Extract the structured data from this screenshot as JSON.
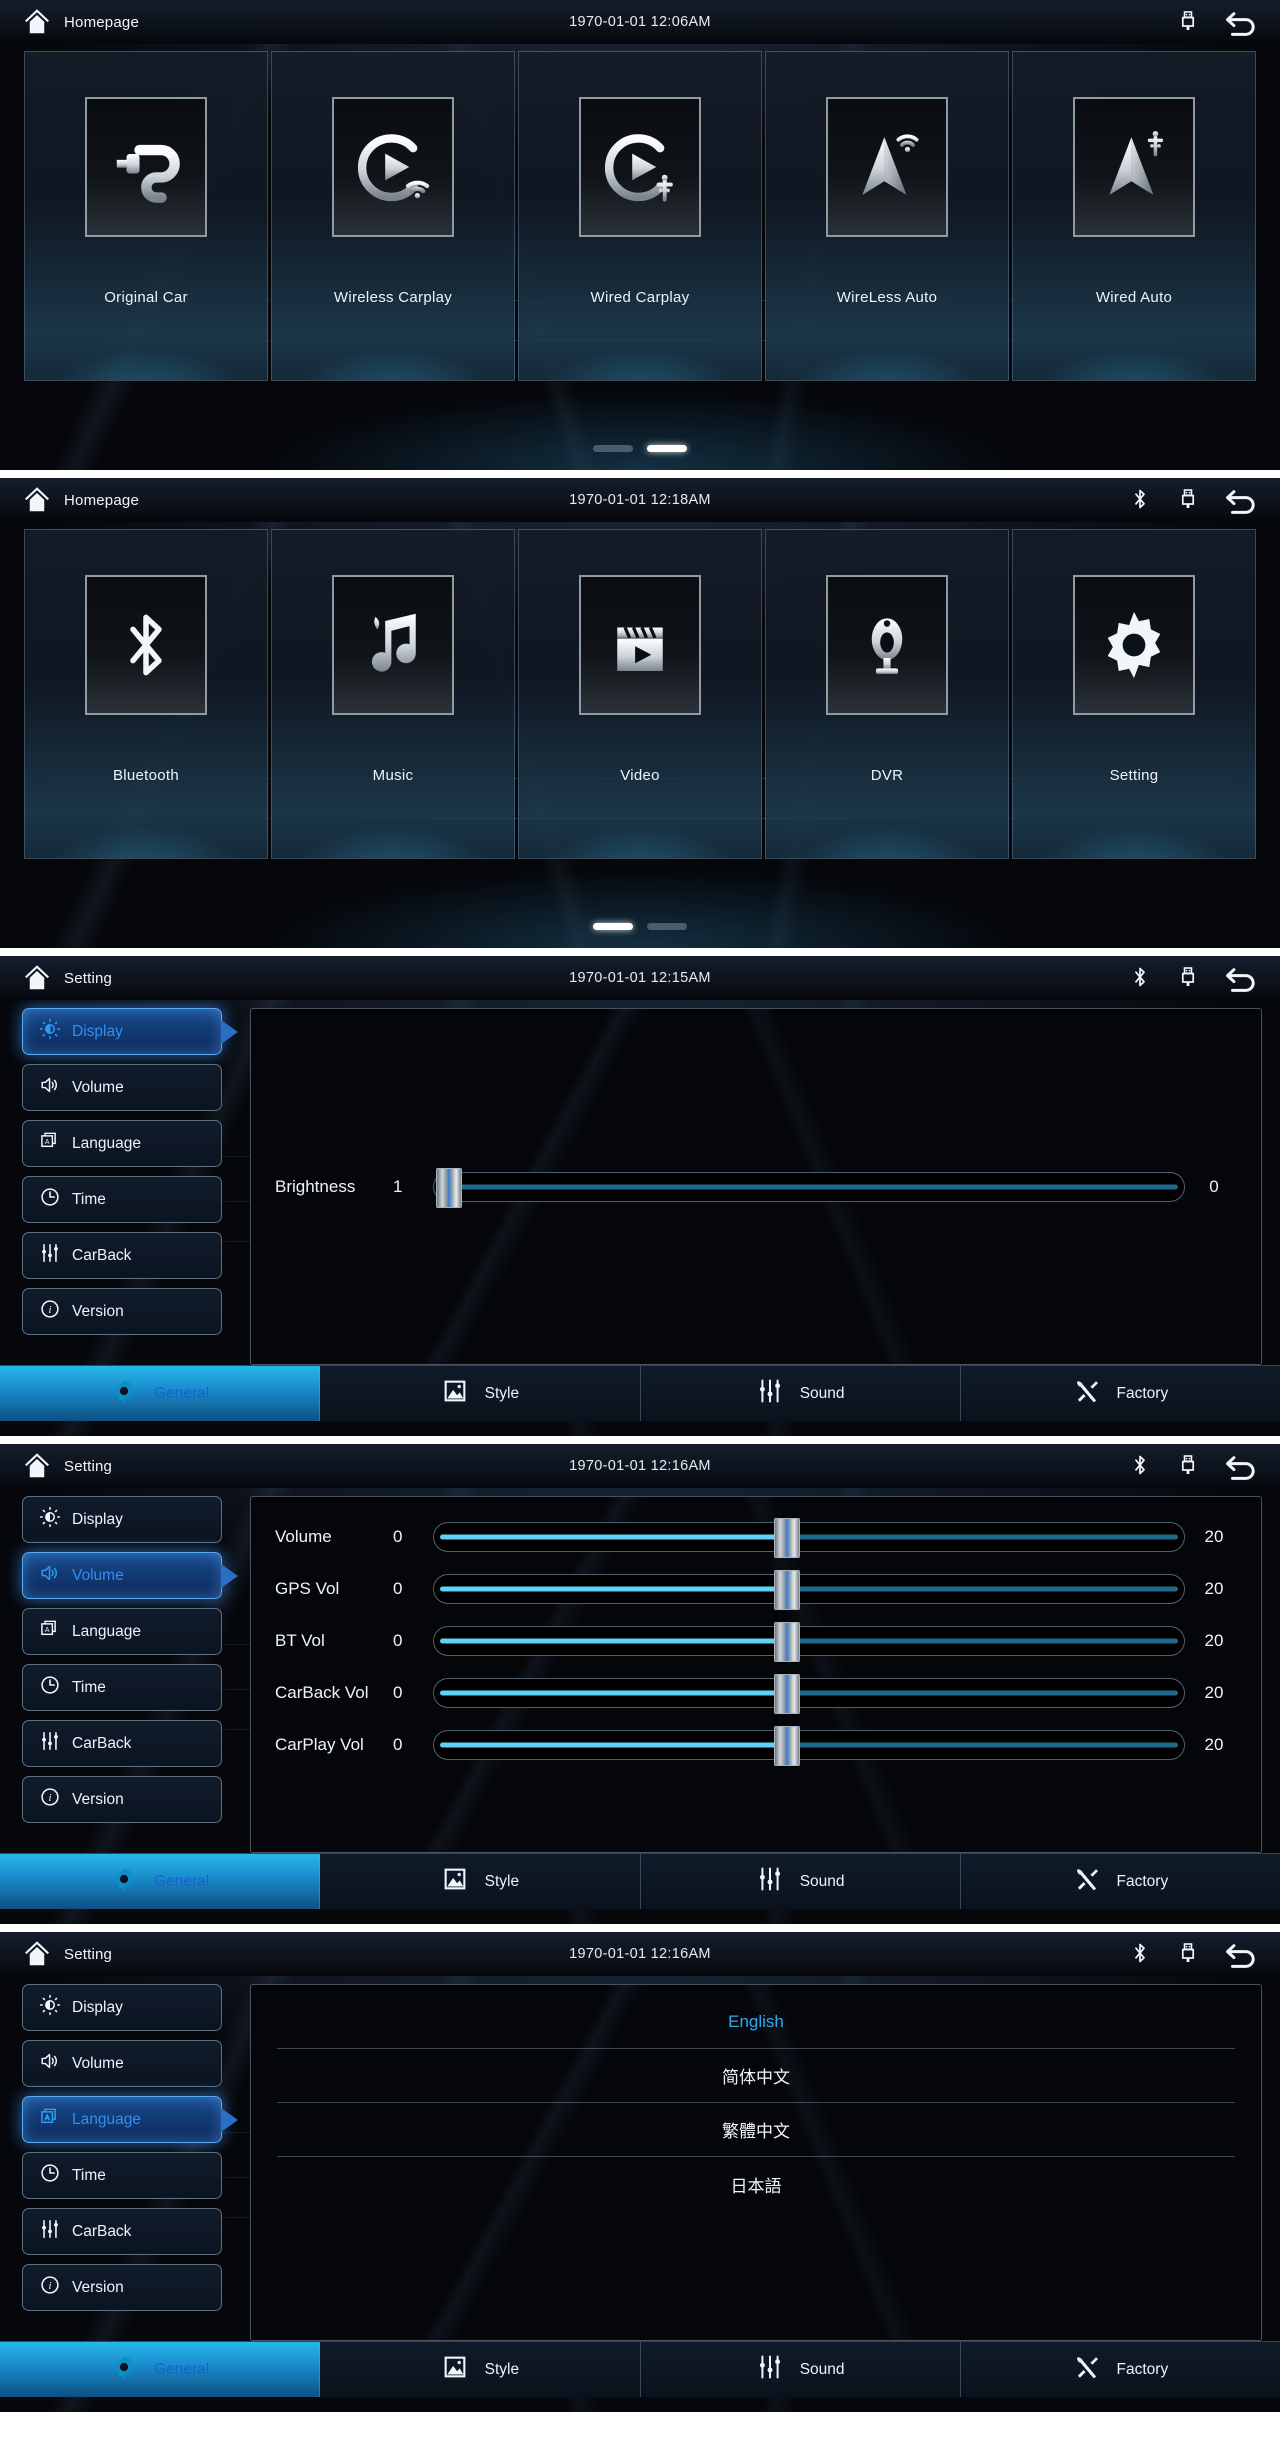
{
  "panels": [
    {
      "kind": "home",
      "header": {
        "title": "Homepage",
        "clock": "1970-01-01 12:06AM",
        "icons": [
          "usb-icon",
          "back-icon"
        ]
      },
      "apps": [
        {
          "label": "Original Car",
          "icon": "plug-icon"
        },
        {
          "label": "Wireless Carplay",
          "icon": "carplay-wireless-icon"
        },
        {
          "label": "Wired Carplay",
          "icon": "carplay-wired-icon"
        },
        {
          "label": "WireLess Auto",
          "icon": "android-auto-wireless-icon"
        },
        {
          "label": "Wired Auto",
          "icon": "android-auto-wired-icon"
        }
      ],
      "pager": {
        "count": 2,
        "active": 1
      }
    },
    {
      "kind": "home",
      "header": {
        "title": "Homepage",
        "clock": "1970-01-01 12:18AM",
        "icons": [
          "bluetooth-icon",
          "usb-icon",
          "back-icon"
        ]
      },
      "apps": [
        {
          "label": "Bluetooth",
          "icon": "bluetooth-icon"
        },
        {
          "label": "Music",
          "icon": "music-note-icon"
        },
        {
          "label": "Video",
          "icon": "clapperboard-icon"
        },
        {
          "label": "DVR",
          "icon": "dashcam-icon"
        },
        {
          "label": "Setting",
          "icon": "gear-icon"
        }
      ],
      "pager": {
        "count": 2,
        "active": 0
      }
    },
    {
      "kind": "settings",
      "header": {
        "title": "Setting",
        "clock": "1970-01-01 12:15AM",
        "icons": [
          "bluetooth-icon",
          "usb-icon",
          "back-icon"
        ]
      },
      "sidebar": [
        {
          "label": "Display",
          "icon": "brightness-icon",
          "active": true
        },
        {
          "label": "Volume",
          "icon": "speaker-icon",
          "active": false
        },
        {
          "label": "Language",
          "icon": "language-icon",
          "active": false
        },
        {
          "label": "Time",
          "icon": "clock-icon",
          "active": false
        },
        {
          "label": "CarBack",
          "icon": "sliders-icon",
          "active": false
        },
        {
          "label": "Version",
          "icon": "info-icon",
          "active": false
        }
      ],
      "content_type": "sliders",
      "sliders": [
        {
          "name": "Brightness",
          "min": "1",
          "max": "0",
          "percent": 2
        }
      ],
      "tabs": [
        {
          "label": "General",
          "icon": "gear-icon",
          "active": true
        },
        {
          "label": "Style",
          "icon": "picture-icon",
          "active": false
        },
        {
          "label": "Sound",
          "icon": "sliders-icon",
          "active": false
        },
        {
          "label": "Factory",
          "icon": "tools-icon",
          "active": false
        }
      ]
    },
    {
      "kind": "settings",
      "header": {
        "title": "Setting",
        "clock": "1970-01-01 12:16AM",
        "icons": [
          "bluetooth-icon",
          "usb-icon",
          "back-icon"
        ]
      },
      "sidebar": [
        {
          "label": "Display",
          "icon": "brightness-icon",
          "active": false
        },
        {
          "label": "Volume",
          "icon": "speaker-icon",
          "active": true
        },
        {
          "label": "Language",
          "icon": "language-icon",
          "active": false
        },
        {
          "label": "Time",
          "icon": "clock-icon",
          "active": false
        },
        {
          "label": "CarBack",
          "icon": "sliders-icon",
          "active": false
        },
        {
          "label": "Version",
          "icon": "info-icon",
          "active": false
        }
      ],
      "content_type": "sliders",
      "sliders": [
        {
          "name": "Volume",
          "min": "0",
          "max": "20",
          "percent": 47
        },
        {
          "name": "GPS Vol",
          "min": "0",
          "max": "20",
          "percent": 47
        },
        {
          "name": "BT Vol",
          "min": "0",
          "max": "20",
          "percent": 47
        },
        {
          "name": "CarBack Vol",
          "min": "0",
          "max": "20",
          "percent": 47
        },
        {
          "name": "CarPlay Vol",
          "min": "0",
          "max": "20",
          "percent": 47
        }
      ],
      "tabs": [
        {
          "label": "General",
          "icon": "gear-icon",
          "active": true
        },
        {
          "label": "Style",
          "icon": "picture-icon",
          "active": false
        },
        {
          "label": "Sound",
          "icon": "sliders-icon",
          "active": false
        },
        {
          "label": "Factory",
          "icon": "tools-icon",
          "active": false
        }
      ]
    },
    {
      "kind": "settings",
      "header": {
        "title": "Setting",
        "clock": "1970-01-01 12:16AM",
        "icons": [
          "bluetooth-icon",
          "usb-icon",
          "back-icon"
        ]
      },
      "sidebar": [
        {
          "label": "Display",
          "icon": "brightness-icon",
          "active": false
        },
        {
          "label": "Volume",
          "icon": "speaker-icon",
          "active": false
        },
        {
          "label": "Language",
          "icon": "language-icon",
          "active": true
        },
        {
          "label": "Time",
          "icon": "clock-icon",
          "active": false
        },
        {
          "label": "CarBack",
          "icon": "sliders-icon",
          "active": false
        },
        {
          "label": "Version",
          "icon": "info-icon",
          "active": false
        }
      ],
      "content_type": "languages",
      "languages": [
        {
          "label": "English",
          "selected": true
        },
        {
          "label": "简体中文",
          "selected": false
        },
        {
          "label": "繁體中文",
          "selected": false
        },
        {
          "label": "日本語",
          "selected": false
        }
      ],
      "tabs": [
        {
          "label": "General",
          "icon": "gear-icon",
          "active": true
        },
        {
          "label": "Style",
          "icon": "picture-icon",
          "active": false
        },
        {
          "label": "Sound",
          "icon": "sliders-icon",
          "active": false
        },
        {
          "label": "Factory",
          "icon": "tools-icon",
          "active": false
        }
      ]
    }
  ],
  "colors": {
    "accent_blue": "#2f8ef5",
    "slider_fill": "#5fd2f8",
    "slider_rest": "#1d6a8c",
    "tab_active": "#1a8fce",
    "lang_selected": "#35a9ef"
  }
}
